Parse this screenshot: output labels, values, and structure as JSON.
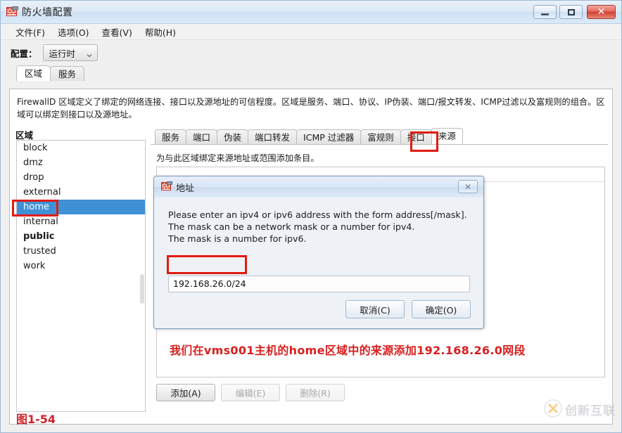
{
  "window": {
    "title": "防火墙配置",
    "icon": "firewall-icon",
    "buttons": {
      "minimize": "minimize-icon",
      "maximize": "maximize-icon",
      "close": "✕"
    }
  },
  "menubar": {
    "items": [
      {
        "label": "文件(F)"
      },
      {
        "label": "选项(O)"
      },
      {
        "label": "查看(V)"
      },
      {
        "label": "帮助(H)"
      }
    ]
  },
  "config": {
    "label": "配置：",
    "value": "运行时",
    "caret": "chevron-down-icon"
  },
  "top_tabs": [
    {
      "label": "区域",
      "active": true
    },
    {
      "label": "服务",
      "active": false
    }
  ],
  "description": "FirewallD 区域定义了绑定的网络连接、接口以及源地址的可信程度。区域是服务、端口、协议、IP伪装、端口/报文转发、ICMP过滤以及富规则的组合。区域可以绑定到接口以及源地址。",
  "zones": {
    "label": "区域",
    "items": [
      {
        "name": "block",
        "bold": false,
        "selected": false
      },
      {
        "name": "dmz",
        "bold": false,
        "selected": false
      },
      {
        "name": "drop",
        "bold": false,
        "selected": false
      },
      {
        "name": "external",
        "bold": false,
        "selected": false
      },
      {
        "name": "home",
        "bold": false,
        "selected": true
      },
      {
        "name": "internal",
        "bold": false,
        "selected": false
      },
      {
        "name": "public",
        "bold": true,
        "selected": false
      },
      {
        "name": "trusted",
        "bold": false,
        "selected": false
      },
      {
        "name": "work",
        "bold": false,
        "selected": false
      }
    ]
  },
  "sub_tabs": [
    {
      "label": "服务",
      "active": false
    },
    {
      "label": "端口",
      "active": false
    },
    {
      "label": "伪装",
      "active": false
    },
    {
      "label": "端口转发",
      "active": false
    },
    {
      "label": "ICMP 过滤器",
      "active": false
    },
    {
      "label": "富规则",
      "active": false
    },
    {
      "label": "接口",
      "active": false
    },
    {
      "label": "来源",
      "active": true
    }
  ],
  "subtab_description": "为与此区域绑定来源地址或范围添加条目。",
  "source_list": {
    "rows": []
  },
  "bottom_buttons": [
    {
      "label": "添加(A)",
      "disabled": false
    },
    {
      "label": "编辑(E)",
      "disabled": true
    },
    {
      "label": "删除(R)",
      "disabled": true
    }
  ],
  "dialog": {
    "title": "地址",
    "icon": "firewall-icon",
    "close_glyph": "✕",
    "message_line1": "Please enter an ipv4 or ipv6 address with the form address[/mask].",
    "message_line2": "The mask can be a network mask or a number for ipv4.",
    "message_line3": "The mask is a number for ipv6.",
    "input_value": "192.168.26.0/24",
    "input_placeholder": "",
    "cancel_label": "取消(C)",
    "ok_label": "确定(O)"
  },
  "annotation": "我们在vms001主机的home区域中的来源添加192.168.26.0网段",
  "figure_caption": "图1-54",
  "watermark": {
    "text": "创新互联",
    "logo": "circle-x-logo"
  },
  "colors": {
    "selection_blue": "#3f91d6",
    "highlight_red": "#e01b10",
    "annotation_red": "#d81f1f",
    "caption_red": "#cf2027",
    "title_bar": "#dce9f7"
  }
}
